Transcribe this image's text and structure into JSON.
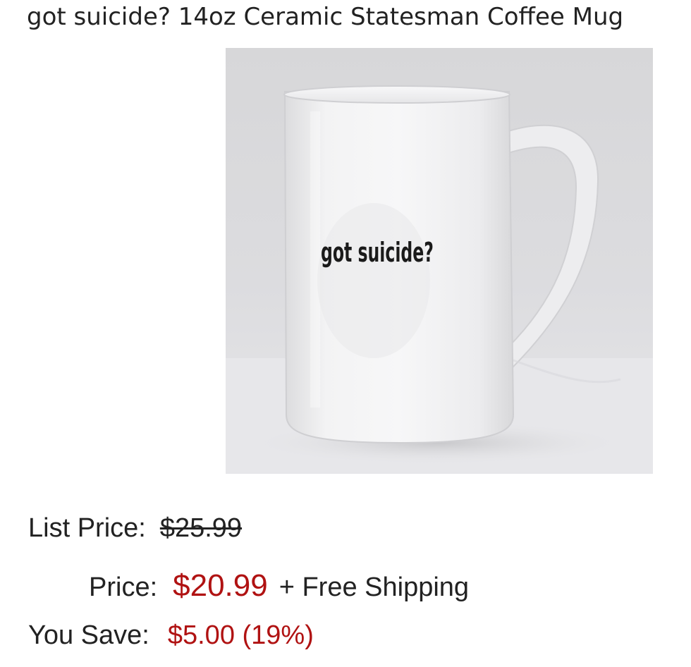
{
  "product": {
    "title": "got suicide? 14oz Ceramic Statesman Coffee Mug",
    "image": {
      "printed_text": "got suicide?",
      "icon": "mug-product-photo"
    }
  },
  "pricing": {
    "list_price_label": "List Price:",
    "list_price_value": "$25.99",
    "price_label": "Price:",
    "price_value": "$20.99",
    "shipping_text": "+ Free Shipping",
    "you_save_label": "You Save:",
    "you_save_value": "$5.00 (19%)"
  },
  "colors": {
    "price_red": "#b01212",
    "text": "#222222"
  }
}
